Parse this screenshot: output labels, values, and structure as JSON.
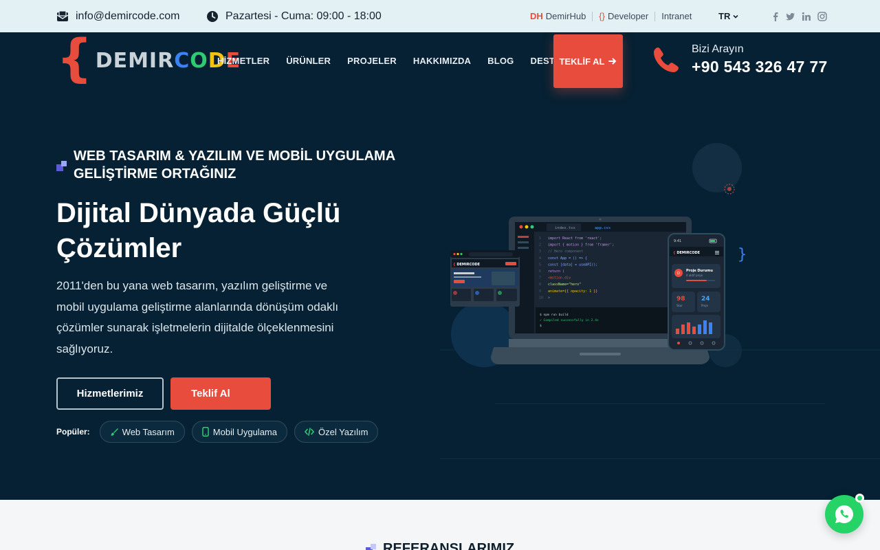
{
  "topbar": {
    "email": "info@demircode.com",
    "hours": "Pazartesi - Cuma: 09:00 - 18:00",
    "links": [
      {
        "prefix": "DH",
        "label": "DemirHub"
      },
      {
        "prefix": "{}",
        "label": "Developer"
      },
      {
        "prefix": "",
        "label": "Intranet"
      }
    ],
    "language": "TR",
    "socials": [
      "facebook-icon",
      "twitter-icon",
      "linkedin-icon",
      "instagram-icon"
    ]
  },
  "brand": {
    "brace": "{",
    "name_part1": "DEMIR",
    "name_part2": "CODE",
    "colors": {
      "accent": "#e74c3c",
      "dark": "#062133",
      "whatsapp": "#25d366"
    }
  },
  "nav": {
    "items": [
      "HİZMETLER",
      "ÜRÜNLER",
      "PROJELER",
      "HAKKIMIZDA",
      "BLOG",
      "DESTEK"
    ],
    "cta": "TEKLİF AL"
  },
  "contact": {
    "label": "Bizi Arayın",
    "phone": "+90 543 326 47 77"
  },
  "hero": {
    "kicker": "WEB TASARIM & YAZILIM VE MOBİL UYGULAMA GELİŞTİRME ORTAĞINIZ",
    "headline": "Dijital Dünyada Güçlü Çözümler",
    "description": "2011'den bu yana web tasarım, yazılım geliştirme ve mobil uygulama geliştirme alanlarında dönüşüm odaklı çözümler sunarak işletmelerin dijitalde ölçeklenmesini sağlıyoruz.",
    "primary_button": "Hizmetlerimiz",
    "secondary_button": "Teklif Al",
    "popular_label": "Popüler:",
    "popular_tags": [
      {
        "label": "Web Tasarım",
        "icon": "brush-icon"
      },
      {
        "label": "Mobil Uygulama",
        "icon": "mobile-icon"
      },
      {
        "label": "Özel Yazılım",
        "icon": "code-icon"
      }
    ]
  },
  "illustration": {
    "tabs": [
      "index.tsx",
      "app.css"
    ],
    "code_lines": [
      "import React from 'react';",
      "import { motion } from 'framer';",
      "// Hero component",
      "const App = () => {",
      "const [data] = useAPI();",
      "return (",
      "<motion.div",
      "className=\"hero\"",
      "animate={{ opacity: 1 }}",
      ">"
    ],
    "terminal_lines": [
      "$ npm run build",
      "✓ Compiled successfully in 2.4s",
      "$"
    ],
    "phone_time": "9:41",
    "phone_brand": "DEMIRCODE",
    "phone_card_title": "Proje Durumu",
    "phone_card_sub": "4 aktif proje",
    "stat1": "98",
    "stat1_label": "Skor",
    "stat2": "24",
    "stat2_label": "Proje"
  },
  "references": {
    "title": "REFERANSLARIMIZ"
  }
}
